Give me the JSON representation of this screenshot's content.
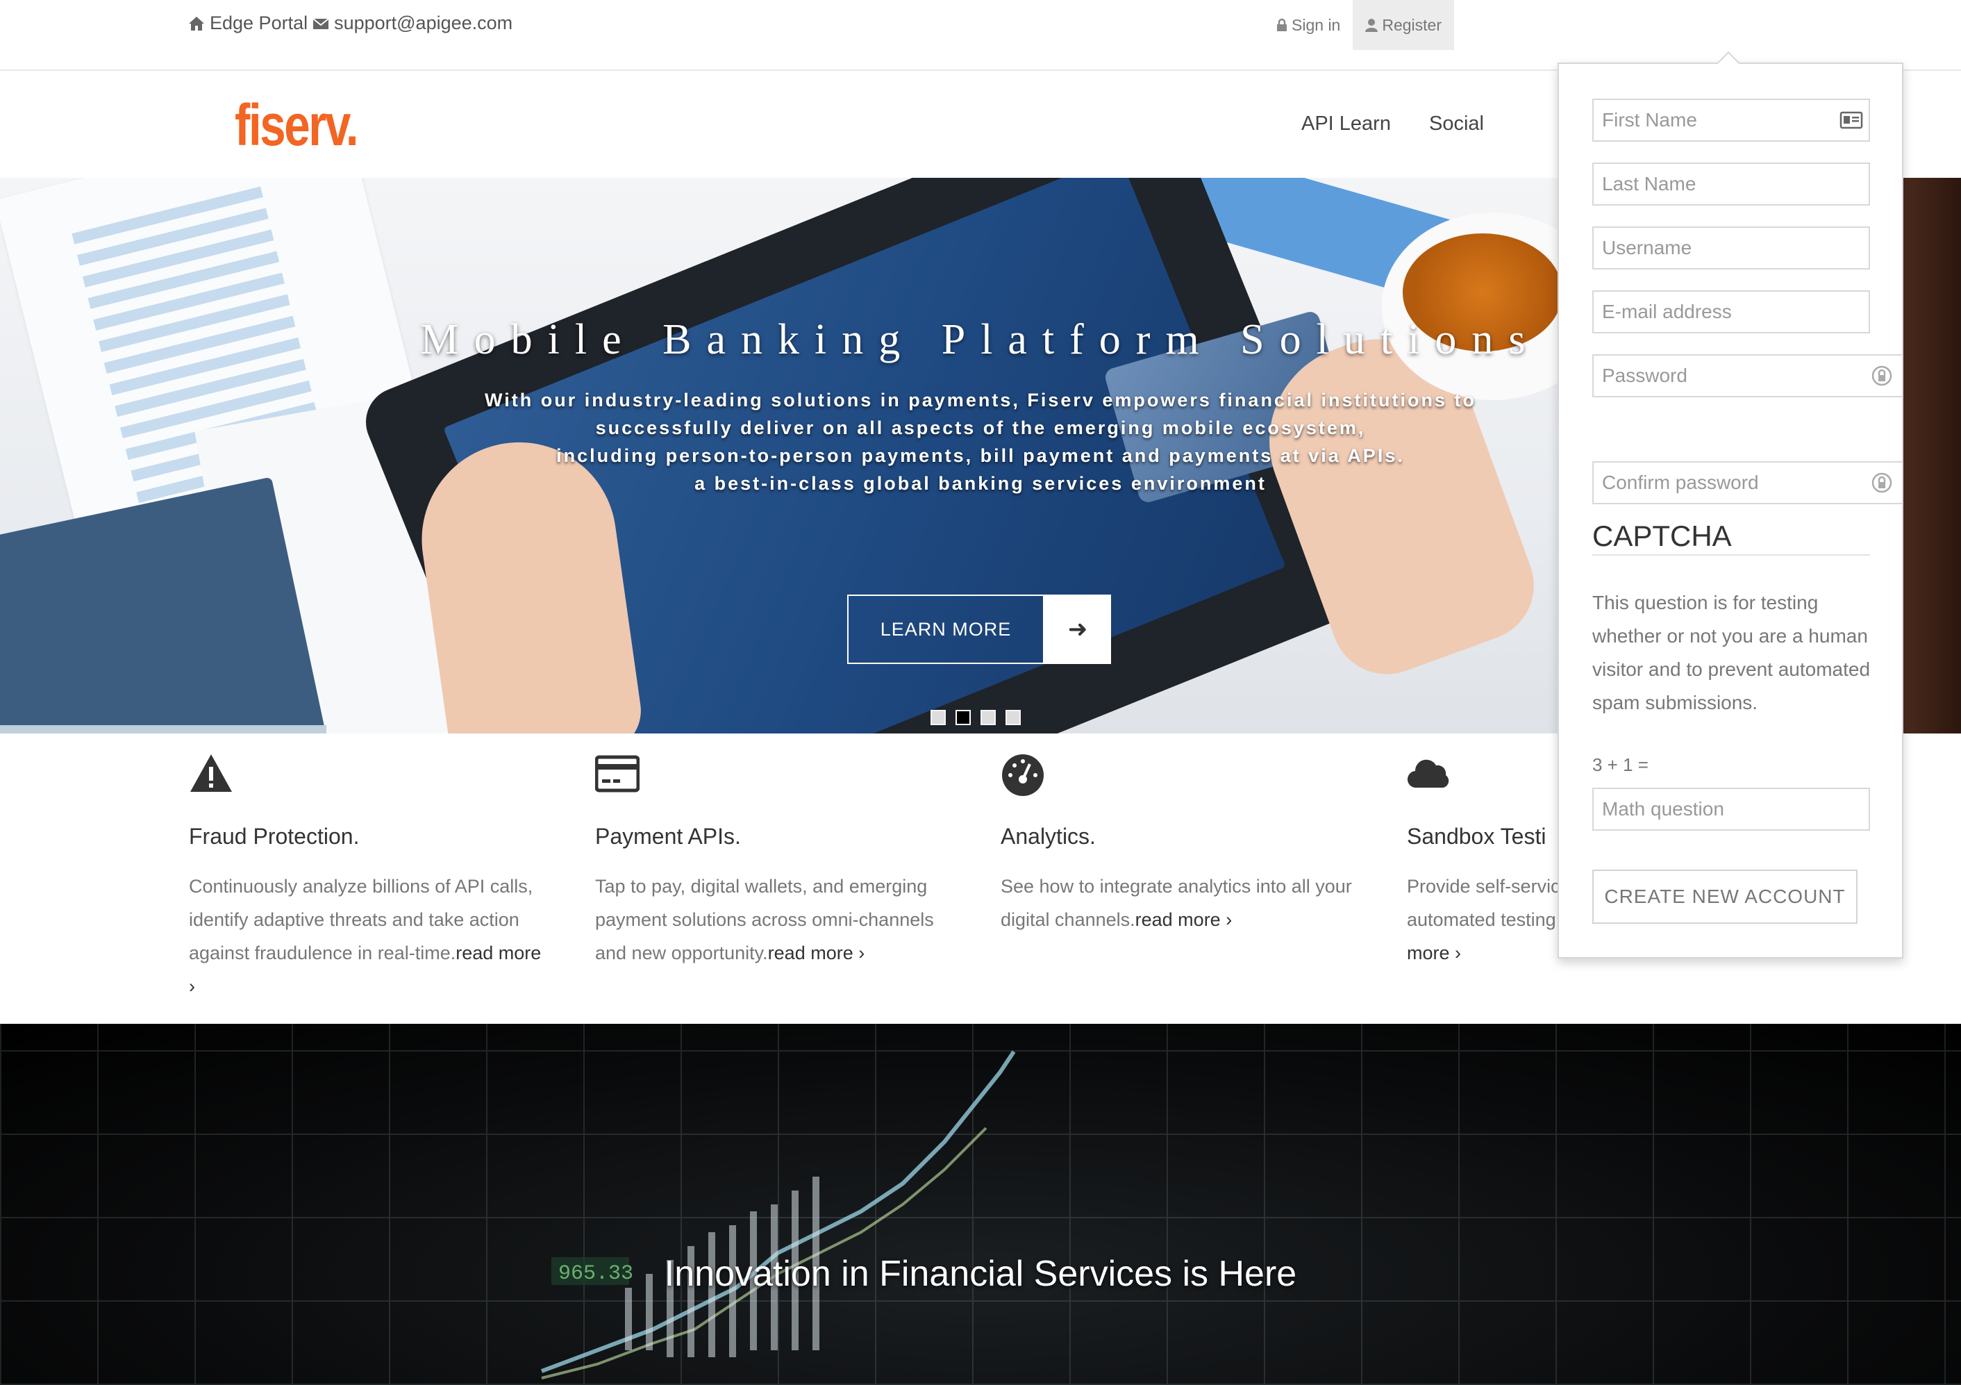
{
  "topbar": {
    "portal_label": "Edge Portal",
    "email": "support@apigee.com",
    "sign_in": "Sign in",
    "register": "Register"
  },
  "header": {
    "logo_text": "fiserv.",
    "nav": [
      "API Learn",
      "Social"
    ]
  },
  "hero": {
    "title": "Mobile Banking Platform Solutions",
    "subtitle_lines": [
      "With our industry-leading solutions in payments, Fiserv empowers financial institutions to",
      "successfully deliver on all aspects of the emerging mobile ecosystem,",
      "including person-to-person payments, bill payment and payments at via APIs.",
      "a best-in-class global banking services environment"
    ],
    "learn_more": "LEARN MORE",
    "slide_count": 4,
    "active_slide": 2
  },
  "features": [
    {
      "icon": "warning-icon",
      "title": "Fraud Protection.",
      "text": "Continuously analyze billions of API calls, identify adaptive threats and take action against fraudulence in real-time.",
      "more": "read more ›"
    },
    {
      "icon": "credit-card-icon",
      "title": "Payment APIs.",
      "text": "Tap to pay, digital wallets, and emerging payment solutions across omni-channels and new opportunity.",
      "more": "read more ›"
    },
    {
      "icon": "dashboard-icon",
      "title": "Analytics.",
      "text": "See how to integrate analytics into all your digital channels.",
      "more": "read more ›"
    },
    {
      "icon": "cloud-icon",
      "title": "Sandbox Testi",
      "text": "Provide self-servic automated testing",
      "more": "more ›"
    }
  ],
  "banner": {
    "title": "Innovation in Financial Services is Here",
    "ticker": "965.33"
  },
  "register_form": {
    "first_name_placeholder": "First Name",
    "last_name_placeholder": "Last Name",
    "username_placeholder": "Username",
    "email_placeholder": "E-mail address",
    "password_placeholder": "Password",
    "confirm_password_placeholder": "Confirm password",
    "captcha_heading": "CAPTCHA",
    "captcha_description": "This question is for testing whether or not you are a human visitor and to prevent automated spam submissions.",
    "math_question": "3 + 1 =",
    "math_placeholder": "Math question",
    "submit_label": "CREATE NEW ACCOUNT"
  },
  "colors": {
    "brand_orange": "#f26522",
    "text_dark": "#333333",
    "text_muted": "#777777"
  }
}
